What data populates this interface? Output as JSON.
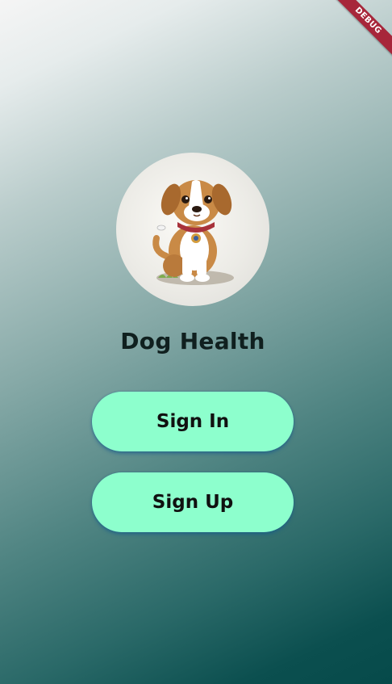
{
  "debug_banner": {
    "label": "DEBUG"
  },
  "avatar": {
    "icon": "puppy-illustration"
  },
  "app": {
    "title": "Dog Health"
  },
  "buttons": {
    "sign_in_label": "Sign In",
    "sign_up_label": "Sign Up"
  },
  "colors": {
    "button_background": "#8dffcd",
    "title_text": "#10201f",
    "debug_ribbon": "#a7263a"
  }
}
